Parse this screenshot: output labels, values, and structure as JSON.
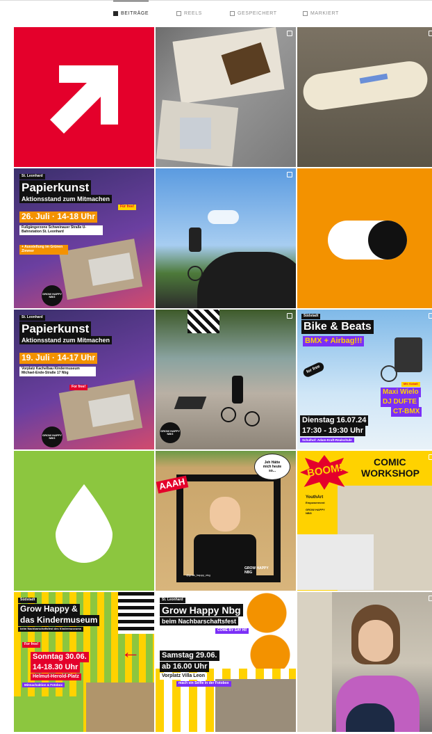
{
  "tabs": [
    {
      "label": "BEITRÄGE",
      "active": true,
      "icon": "grid-icon"
    },
    {
      "label": "REELS",
      "active": false,
      "icon": "reels-icon"
    },
    {
      "label": "GESPEICHERT",
      "active": false,
      "icon": "bookmark-icon"
    },
    {
      "label": "MARKIERT",
      "active": false,
      "icon": "tagged-icon"
    }
  ],
  "colors": {
    "red": "#e4002b",
    "orange": "#f39200",
    "green": "#8cc63f",
    "yellow": "#ffd200",
    "purple": "#7b2ff7"
  },
  "posts": {
    "p4": {
      "district": "St. Leonhard",
      "title": "Papierkunst",
      "subtitle": "Aktionsstand zum Mitmachen",
      "free": "Für free!",
      "date": "26. Juli · 14-18 Uhr",
      "place": "Fußgängerzone Schweinauer Straße U-Bahnstation St. Leonhard",
      "note": "+ Ausstellung im Grünen Zimmer",
      "logo": "GROW HAPPY NBG"
    },
    "p7": {
      "district": "St. Leonhard",
      "title": "Papierkunst",
      "subtitle": "Aktionsstand zum Mitmachen",
      "date": "19. Juli · 14-17 Uhr",
      "place": "Vorplatz Kachelbau Kindermuseum Michael-Ende-Straße 17 Nbg",
      "free": "For free!",
      "logo": "GROW HAPPY NBG"
    },
    "p8": {
      "logo": "GROW HAPPY NBG"
    },
    "p9": {
      "district": "Südstadt",
      "title": "Bike & Beats",
      "subtitle": "BMX + Airbag!!!",
      "free": "for free",
      "lineup1": "Mit: Kobalt",
      "lineup2": "Maxi Wielo",
      "lineup3": "DJ DUFTE",
      "lineup4": "CT-BMX",
      "date": "Dienstag 16.07.24",
      "time": "17:30 - 19:30 Uhr",
      "place": "Schulhof: Adam-Kraft-Realschule"
    },
    "p11": {
      "bubble": "Jeh Hätte mich heute so...",
      "sticker": "AAAH",
      "handle": "@grow_happy_nbg",
      "logo": "GROW HAPPY NBG"
    },
    "p12": {
      "boom": "BOOM!",
      "title1": "COMIC",
      "title2": "WORKSHOP",
      "org1": "YouthArt",
      "org2": "Empowerment",
      "logo": "GROW HAPPY NBG"
    },
    "p13": {
      "district": "Südstadt",
      "title1": "Grow Happy &",
      "title2": "das Kindermuseum",
      "subtitle": "beim Nachbarschaftsfest des Kindermuseums",
      "free": "For free!",
      "date1": "Sonntag 30.06.",
      "date2": "14-18.30 Uhr",
      "place": "Helmut-Herold-Platz",
      "extra": "Mitmachaktion & Fotobox"
    },
    "p14": {
      "district": "St. Leonhard",
      "title1": "Grow Happy Nbg",
      "title2": "beim Nachbarschaftsfest",
      "come": "COME BY SAY HI!",
      "date1": "Samstag 29.06.",
      "date2": "ab 16.00 Uhr",
      "place": "Vorplatz Villa Leon",
      "extra": "mach ein Selfie in der Fotobox"
    }
  }
}
